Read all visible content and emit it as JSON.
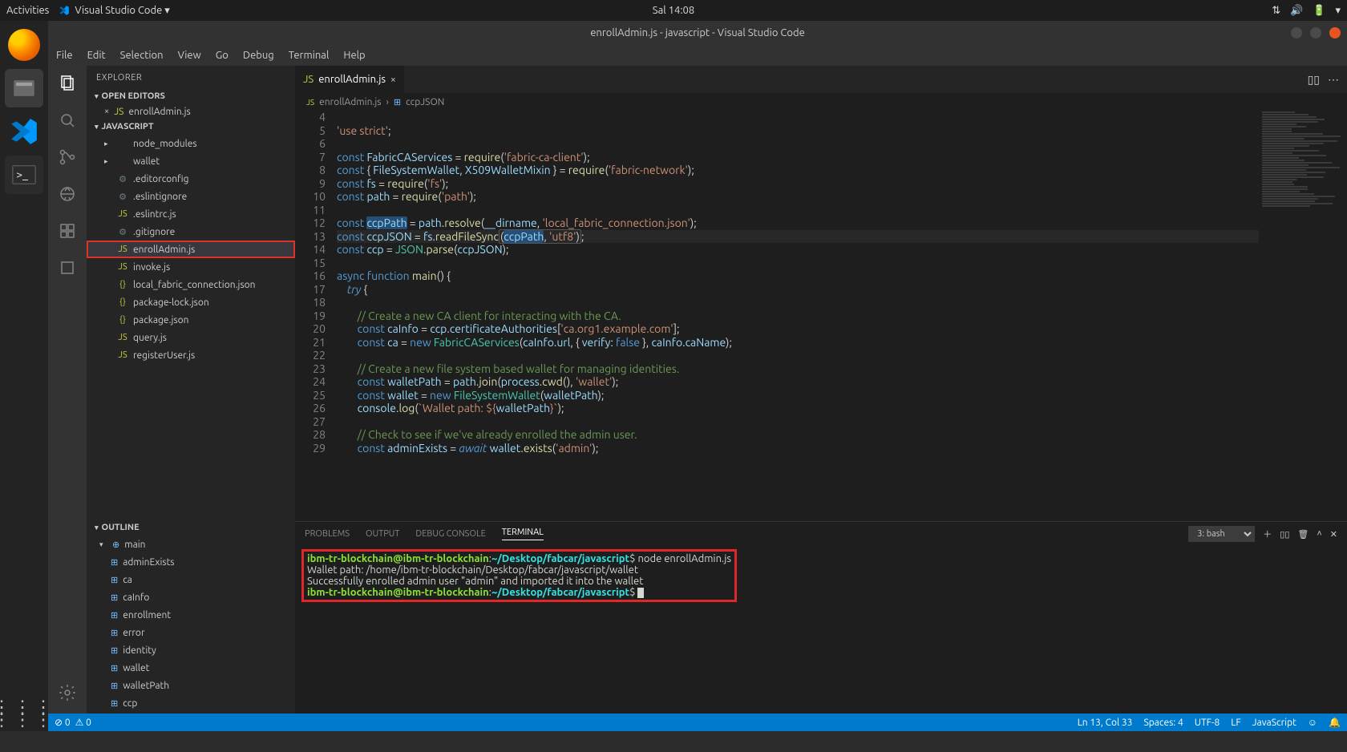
{
  "gnome": {
    "activities": "Activities",
    "app": "Visual Studio Code ▾",
    "clock": "Sal 14:08"
  },
  "window": {
    "title": "enrollAdmin.js - javascript - Visual Studio Code"
  },
  "menu": [
    "File",
    "Edit",
    "Selection",
    "View",
    "Go",
    "Debug",
    "Terminal",
    "Help"
  ],
  "sidebar": {
    "explorer": "EXPLORER",
    "openEditors": "OPEN EDITORS",
    "openFile": "enrollAdmin.js",
    "project": "JAVASCRIPT",
    "files": [
      {
        "name": "node_modules",
        "type": "folder"
      },
      {
        "name": "wallet",
        "type": "folder"
      },
      {
        "name": ".editorconfig",
        "type": "cfg"
      },
      {
        "name": ".eslintignore",
        "type": "cfg"
      },
      {
        "name": ".eslintrc.js",
        "type": "js"
      },
      {
        "name": ".gitignore",
        "type": "cfg"
      },
      {
        "name": "enrollAdmin.js",
        "type": "js",
        "selected": true,
        "hl": true
      },
      {
        "name": "invoke.js",
        "type": "js"
      },
      {
        "name": "local_fabric_connection.json",
        "type": "json"
      },
      {
        "name": "package-lock.json",
        "type": "json"
      },
      {
        "name": "package.json",
        "type": "json"
      },
      {
        "name": "query.js",
        "type": "js"
      },
      {
        "name": "registerUser.js",
        "type": "js"
      }
    ],
    "outline": "OUTLINE",
    "outlineItems": [
      "main",
      "adminExists",
      "ca",
      "caInfo",
      "enrollment",
      "error",
      "identity",
      "wallet",
      "walletPath",
      "ccp"
    ]
  },
  "tab": {
    "name": "enrollAdmin.js"
  },
  "breadcrumb": {
    "file": "enrollAdmin.js",
    "sym": "ccpJSON"
  },
  "code": {
    "lines": [
      4,
      5,
      6,
      7,
      8,
      9,
      10,
      11,
      12,
      13,
      14,
      15,
      16,
      17,
      18,
      19,
      20,
      21,
      22,
      23,
      24,
      25,
      26,
      27,
      28,
      29
    ]
  },
  "panel": {
    "tabs": [
      "PROBLEMS",
      "OUTPUT",
      "DEBUG CONSOLE",
      "TERMINAL"
    ],
    "selector": "3: bash",
    "term": {
      "userhost": "ibm-tr-blockchain@ibm-tr-blockchain",
      "path": "~/Desktop/fabcar/javascript",
      "cmd": "node enrollAdmin.js",
      "l2": "Wallet path: /home/ibm-tr-blockchain/Desktop/fabcar/javascript/wallet",
      "l3": "Successfully enrolled admin user \"admin\" and imported it into the wallet"
    }
  },
  "status": {
    "errors": "0",
    "warnings": "0",
    "pos": "Ln 13, Col 33",
    "spaces": "Spaces: 4",
    "enc": "UTF-8",
    "eol": "LF",
    "lang": "JavaScript"
  }
}
